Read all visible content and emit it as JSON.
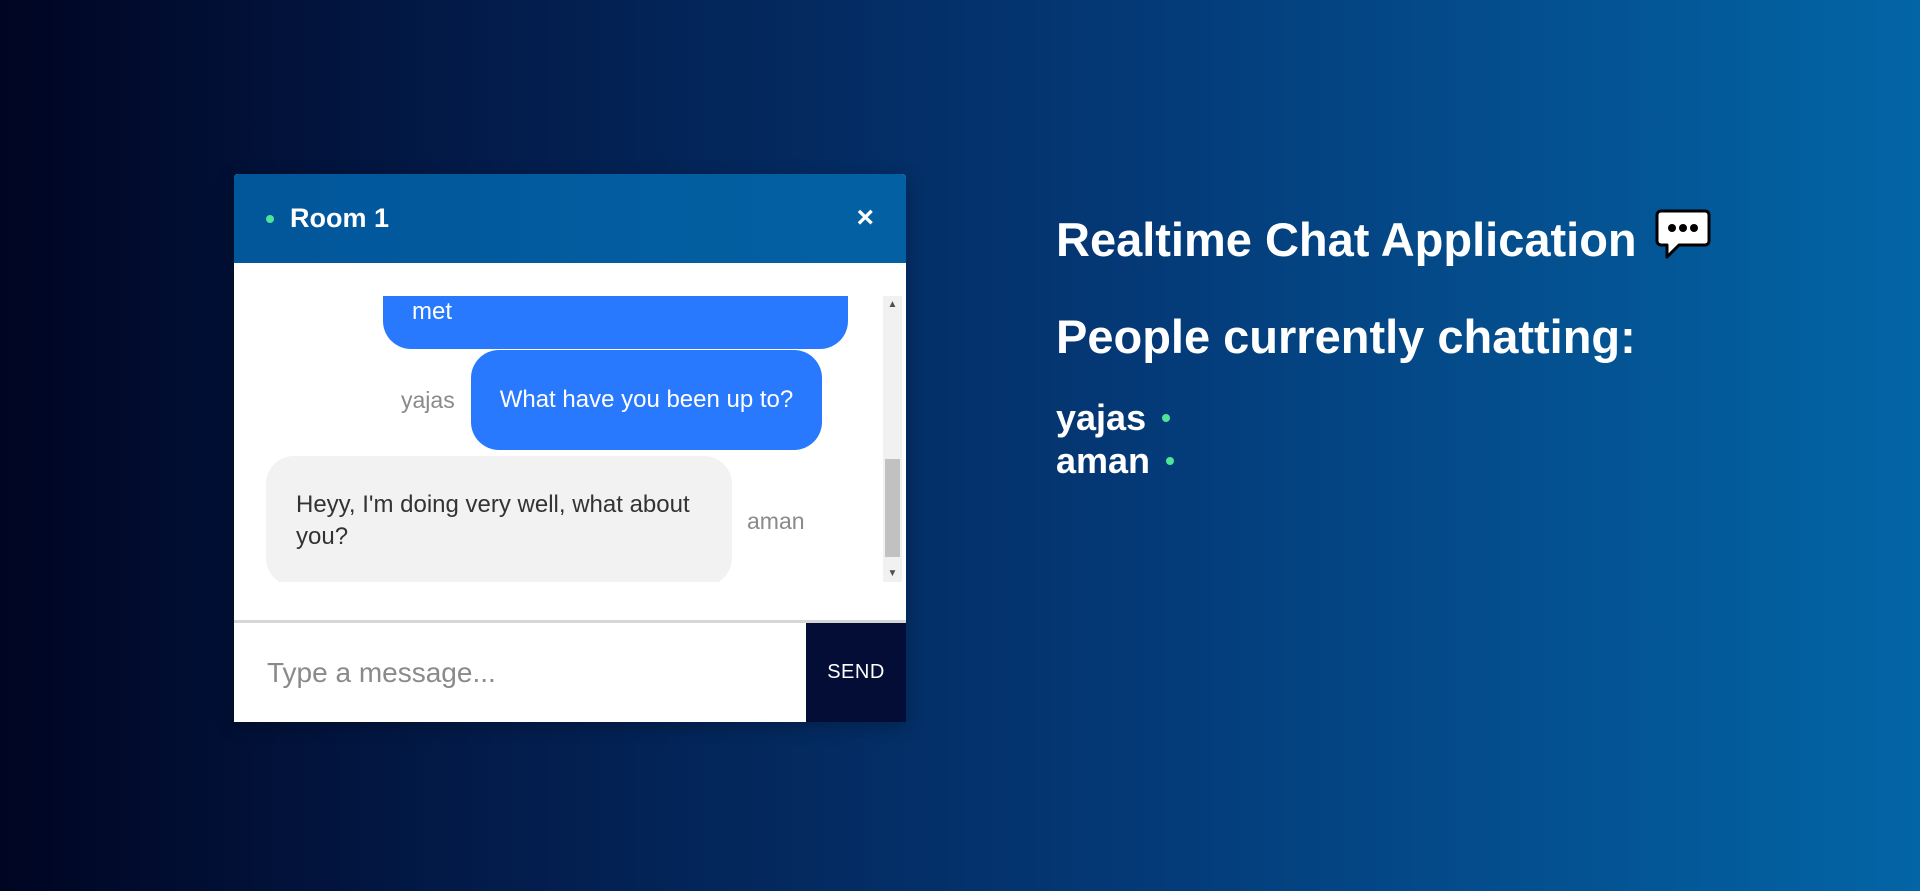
{
  "chat": {
    "room_name": "Room 1",
    "close_symbol": "×",
    "messages": [
      {
        "sender": "",
        "text": "met",
        "direction": "out"
      },
      {
        "sender": "yajas",
        "text": "What have you been up to?",
        "direction": "out"
      },
      {
        "sender": "aman",
        "text": "Heyy, I'm doing very well, what about you?",
        "direction": "in"
      }
    ],
    "input_placeholder": "Type a message...",
    "input_value": "",
    "send_label": "SEND"
  },
  "info": {
    "app_title": "Realtime Chat Application",
    "people_heading": "People currently chatting:",
    "users": [
      {
        "name": "yajas",
        "status": "online"
      },
      {
        "name": "aman",
        "status": "online"
      }
    ]
  },
  "icons": {
    "chat_bubble": "speech-bubble-icon",
    "close": "close-icon",
    "online": "online-status-dot"
  },
  "colors": {
    "accent_blue": "#2979ff",
    "header_blue": "#0361a3",
    "online_green": "#4ee59a",
    "send_dark": "#030d35"
  }
}
